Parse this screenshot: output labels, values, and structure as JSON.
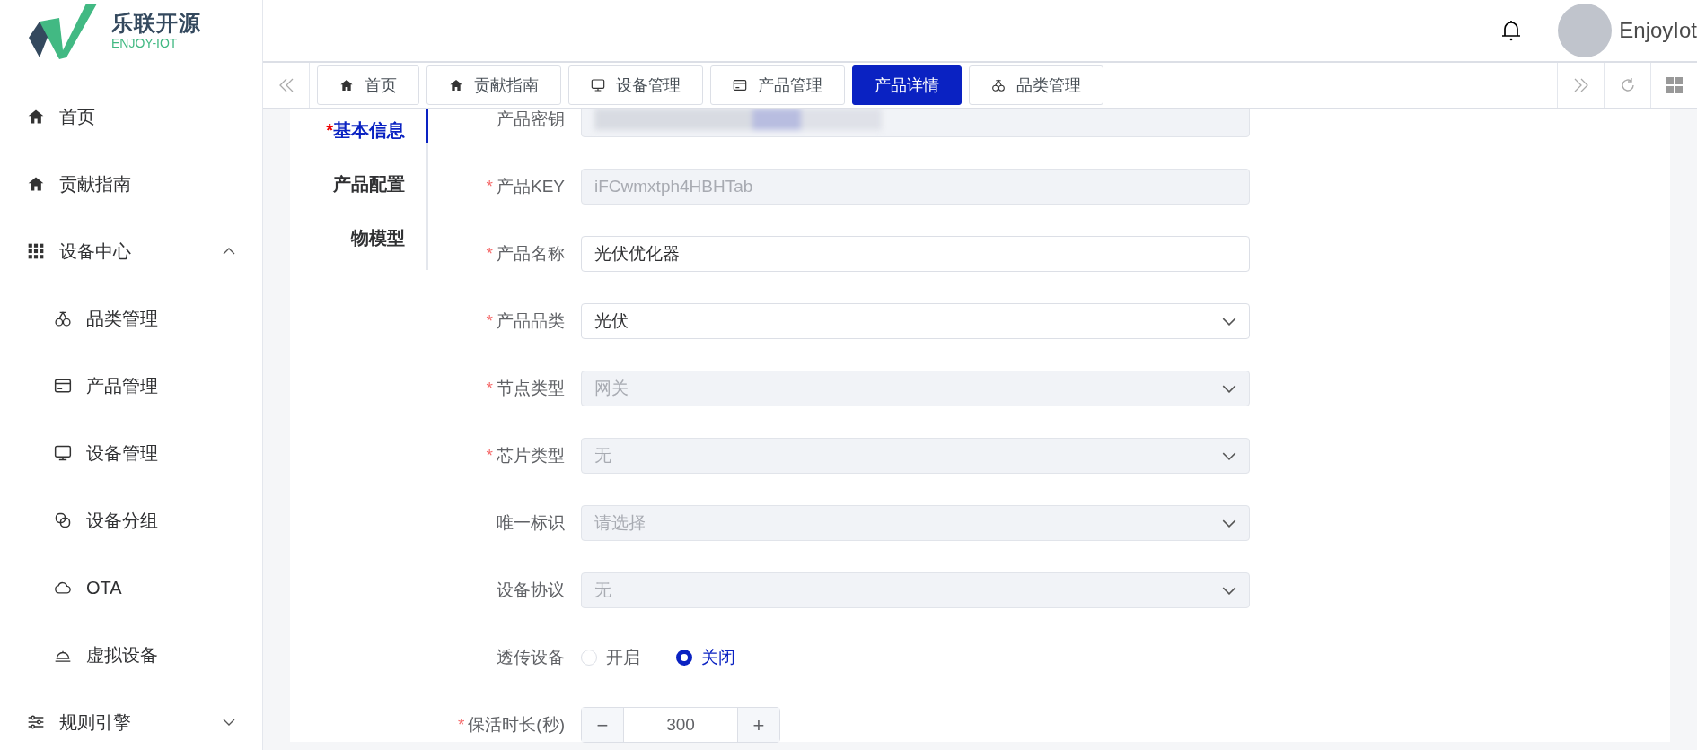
{
  "logo": {
    "title": "乐联开源",
    "subtitle": "ENJOY-IOT"
  },
  "sidebar": {
    "items": [
      {
        "label": "首页"
      },
      {
        "label": "贡献指南"
      },
      {
        "label": "设备中心",
        "expanded": true,
        "children": [
          {
            "label": "品类管理"
          },
          {
            "label": "产品管理"
          },
          {
            "label": "设备管理"
          },
          {
            "label": "设备分组"
          },
          {
            "label": "OTA"
          },
          {
            "label": "虚拟设备"
          }
        ]
      },
      {
        "label": "规则引擎",
        "expanded": false
      }
    ]
  },
  "header": {
    "user": "EnjoyIot"
  },
  "tabs": [
    {
      "label": "首页",
      "selected": false
    },
    {
      "label": "贡献指南",
      "selected": false
    },
    {
      "label": "设备管理",
      "selected": false
    },
    {
      "label": "产品管理",
      "selected": false
    },
    {
      "label": "产品详情",
      "selected": true
    },
    {
      "label": "品类管理",
      "selected": false
    }
  ],
  "required_mark": "*",
  "detail_tabs": [
    {
      "label": "基本信息",
      "required": true,
      "selected": true
    },
    {
      "label": "产品配置",
      "required": false,
      "selected": false
    },
    {
      "label": "物模型",
      "required": false,
      "selected": false
    }
  ],
  "form": {
    "fields": [
      {
        "kind": "secret",
        "label": "产品密钥",
        "required": false,
        "disabled": true
      },
      {
        "kind": "text",
        "label": "产品KEY",
        "required": true,
        "disabled": true,
        "value": "iFCwmxtph4HBHTab"
      },
      {
        "kind": "text",
        "label": "产品名称",
        "required": true,
        "disabled": false,
        "value": "光伏优化器"
      },
      {
        "kind": "select",
        "label": "产品品类",
        "required": true,
        "disabled": false,
        "value": "光伏"
      },
      {
        "kind": "select",
        "label": "节点类型",
        "required": true,
        "disabled": true,
        "value": "网关"
      },
      {
        "kind": "select",
        "label": "芯片类型",
        "required": true,
        "disabled": true,
        "value": "无"
      },
      {
        "kind": "select",
        "label": "唯一标识",
        "required": false,
        "disabled": true,
        "placeholder": "请选择"
      },
      {
        "kind": "select",
        "label": "设备协议",
        "required": false,
        "disabled": true,
        "value": "无"
      },
      {
        "kind": "radio",
        "label": "透传设备",
        "required": false,
        "options": [
          {
            "label": "开启",
            "selected": false
          },
          {
            "label": "关闭",
            "selected": true
          }
        ]
      },
      {
        "kind": "number",
        "label": "保活时长(秒)",
        "required": true,
        "value": "300",
        "minus": "−",
        "plus": "+"
      }
    ]
  }
}
